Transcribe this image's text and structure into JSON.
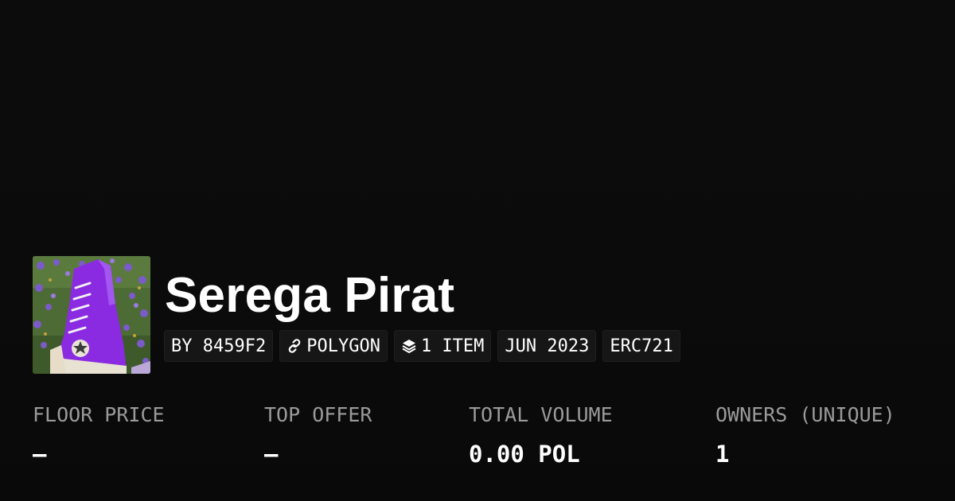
{
  "collection": {
    "name": "Serega Pirat",
    "avatar_icon": "converse-sneaker-flowers-image"
  },
  "meta_pills": [
    {
      "label": "BY 8459F2",
      "icon": ""
    },
    {
      "label": "POLYGON",
      "icon": "polygon-link-icon"
    },
    {
      "label": "1 ITEM",
      "icon": "layers-icon"
    },
    {
      "label": "JUN 2023",
      "icon": ""
    },
    {
      "label": "ERC721",
      "icon": ""
    }
  ],
  "stats": {
    "floor_price": {
      "label": "FLOOR PRICE",
      "value": "–"
    },
    "top_offer": {
      "label": "TOP OFFER",
      "value": "–"
    },
    "total_volume": {
      "label": "TOTAL VOLUME",
      "value": "0.00 POL"
    },
    "owners": {
      "label": "OWNERS (UNIQUE)",
      "value": "1"
    }
  },
  "colors": {
    "background": "#0b0b0b",
    "pill_background": "#161616",
    "label_gray": "#9a9a9a",
    "text_white": "#ffffff"
  }
}
